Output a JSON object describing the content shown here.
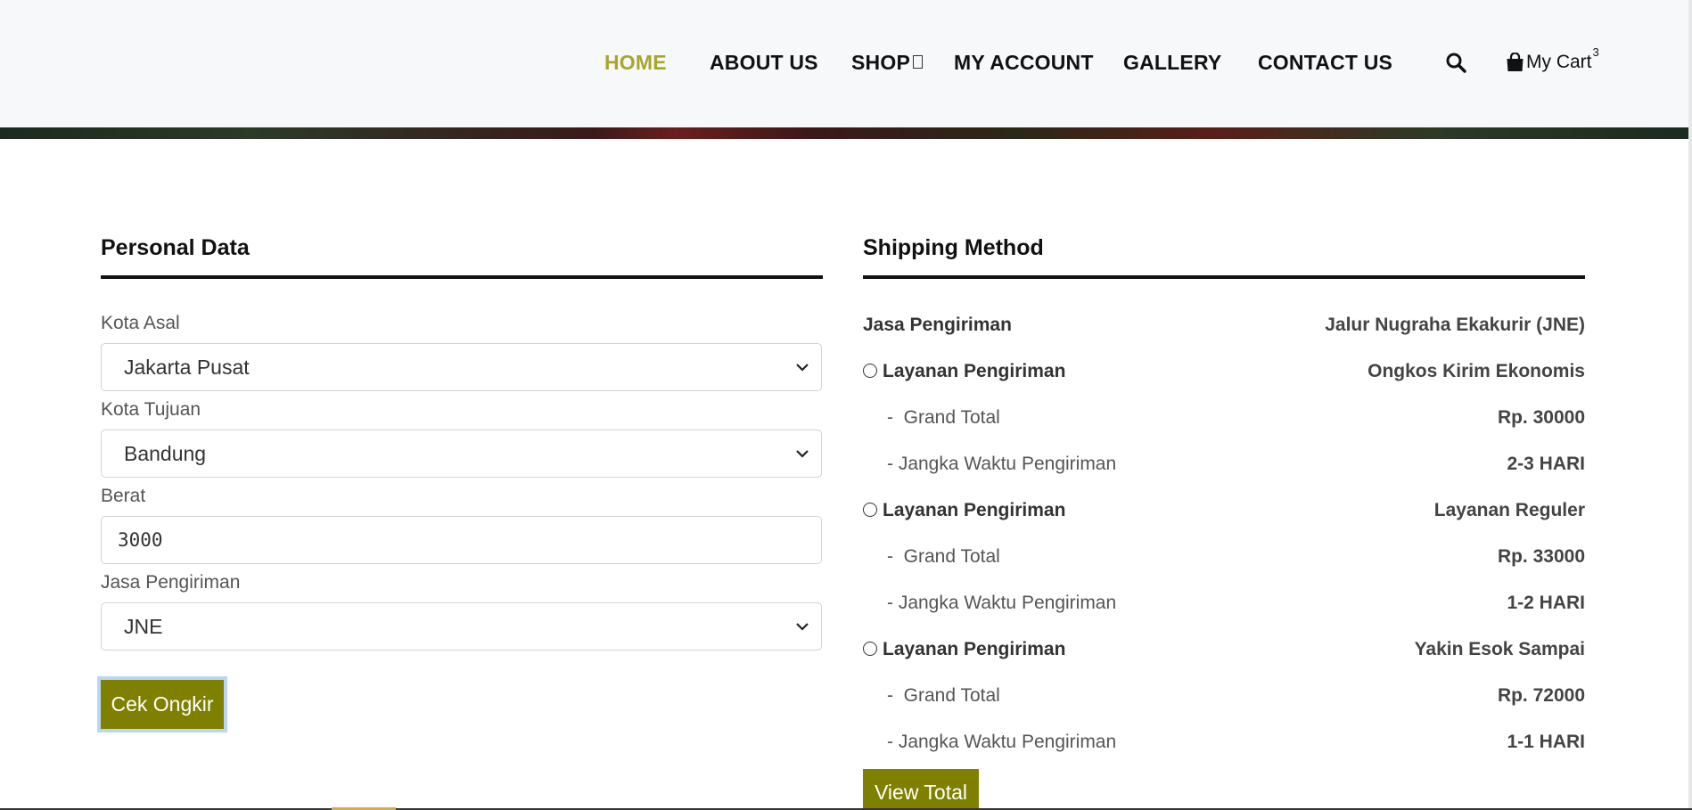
{
  "nav": {
    "items": [
      {
        "label": "HOME",
        "active": true
      },
      {
        "label": "ABOUT US",
        "active": false
      },
      {
        "label": "SHOP",
        "active": false
      },
      {
        "label": "MY ACCOUNT",
        "active": false
      },
      {
        "label": "GALLERY",
        "active": false
      },
      {
        "label": "CONTACT US",
        "active": false
      }
    ],
    "search_icon": "search-icon",
    "cart": {
      "label": "My Cart",
      "count": "3",
      "icon": "shopping-bag-icon"
    }
  },
  "personal": {
    "title": "Personal Data",
    "fields": [
      {
        "label": "Kota Asal",
        "value": "Jakarta Pusat",
        "type": "select"
      },
      {
        "label": "Kota Tujuan",
        "value": "Bandung",
        "type": "select"
      },
      {
        "label": "Berat",
        "value": "3000",
        "type": "input"
      },
      {
        "label": "Jasa Pengiriman",
        "value": "JNE",
        "type": "select"
      }
    ],
    "button": "Cek Ongkir"
  },
  "shipping": {
    "title": "Shipping Method",
    "courier_label": "Jasa Pengiriman",
    "courier_value": "Jalur Nugraha Ekakurir (JNE)",
    "services": [
      {
        "label": "Layanan Pengiriman",
        "name": "Ongkos Kirim Ekonomis",
        "total_label": "-  Grand Total",
        "total": "Rp. 30000",
        "eta_label": "- Jangka Waktu Pengiriman",
        "eta": "2-3 HARI"
      },
      {
        "label": "Layanan Pengiriman",
        "name": "Layanan Reguler",
        "total_label": "-  Grand Total",
        "total": "Rp. 33000",
        "eta_label": "- Jangka Waktu Pengiriman",
        "eta": "1-2 HARI"
      },
      {
        "label": "Layanan Pengiriman",
        "name": "Yakin Esok Sampai",
        "total_label": "-  Grand Total",
        "total": "Rp. 72000",
        "eta_label": "- Jangka Waktu Pengiriman",
        "eta": "1-1 HARI"
      }
    ],
    "button": "View Total"
  },
  "colors": {
    "accent": "#a6a72a",
    "button": "#7f8000",
    "header_bg": "#f7f8fa"
  }
}
